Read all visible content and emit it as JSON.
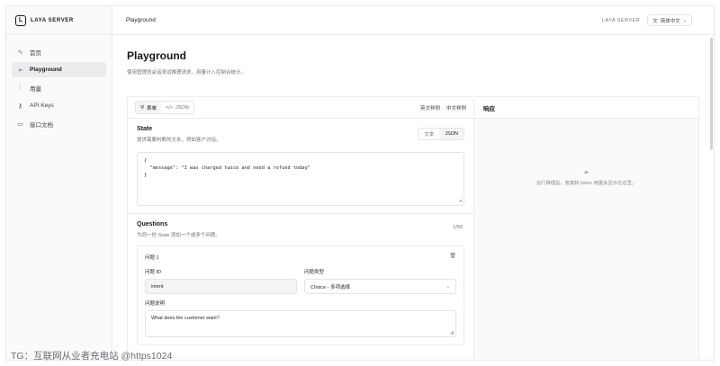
{
  "brand": {
    "name": "LAYA SERVER",
    "logo": "L"
  },
  "sidebar": {
    "items": [
      {
        "label": "首页",
        "icon": "pulse-icon",
        "glyph": "∿",
        "active": false
      },
      {
        "label": "Playground",
        "icon": "send-icon",
        "glyph": "➢",
        "active": true
      },
      {
        "label": "用量",
        "icon": "bar-chart-icon",
        "glyph": "⫶",
        "active": false
      },
      {
        "label": "API Keys",
        "icon": "key-icon",
        "glyph": "⚷",
        "active": false
      },
      {
        "label": "接口文档",
        "icon": "book-icon",
        "glyph": "▭",
        "active": false
      }
    ]
  },
  "topbar": {
    "breadcrumb": "Playground",
    "brand_label": "LAYA SERVER",
    "lang_icon": "translate-icon",
    "lang_label": "简体中文"
  },
  "page": {
    "title": "Playground",
    "description": "使用管理员会话测试推理请求，用量计入控制台统计。"
  },
  "left_panel": {
    "mode_tabs": [
      {
        "label": "表单",
        "icon": "filter-icon",
        "active": true
      },
      {
        "label": "JSON",
        "icon": "code-icon",
        "active": false
      }
    ],
    "links": [
      "英文样例",
      "中文样例"
    ],
    "state": {
      "title": "State",
      "description": "提供需要判断的文本，例如客户对话。",
      "toggle": [
        {
          "label": "文本",
          "active": false
        },
        {
          "label": "JSON",
          "active": true
        }
      ],
      "value": "{\n  \"message\": \"I was charged twice and need a refund today\"\n}"
    },
    "questions": {
      "title": "Questions",
      "count": "1/50",
      "description": "为同一份 State 添加一个或多个问题。",
      "items": [
        {
          "title": "问题 1",
          "id_label": "问题 ID",
          "id_value": "intent",
          "type_label": "问题类型",
          "type_value": "Choice - 多项选择",
          "desc_label": "问题说明",
          "desc_value": "What does the customer want?"
        }
      ]
    }
  },
  "right_panel": {
    "title": "响应",
    "empty_icon": "send-icon",
    "empty_text": "运行推理后，答案和 token 用量会显示在这里。"
  },
  "watermark": "TG：互联网从业者充电站 @https1024"
}
